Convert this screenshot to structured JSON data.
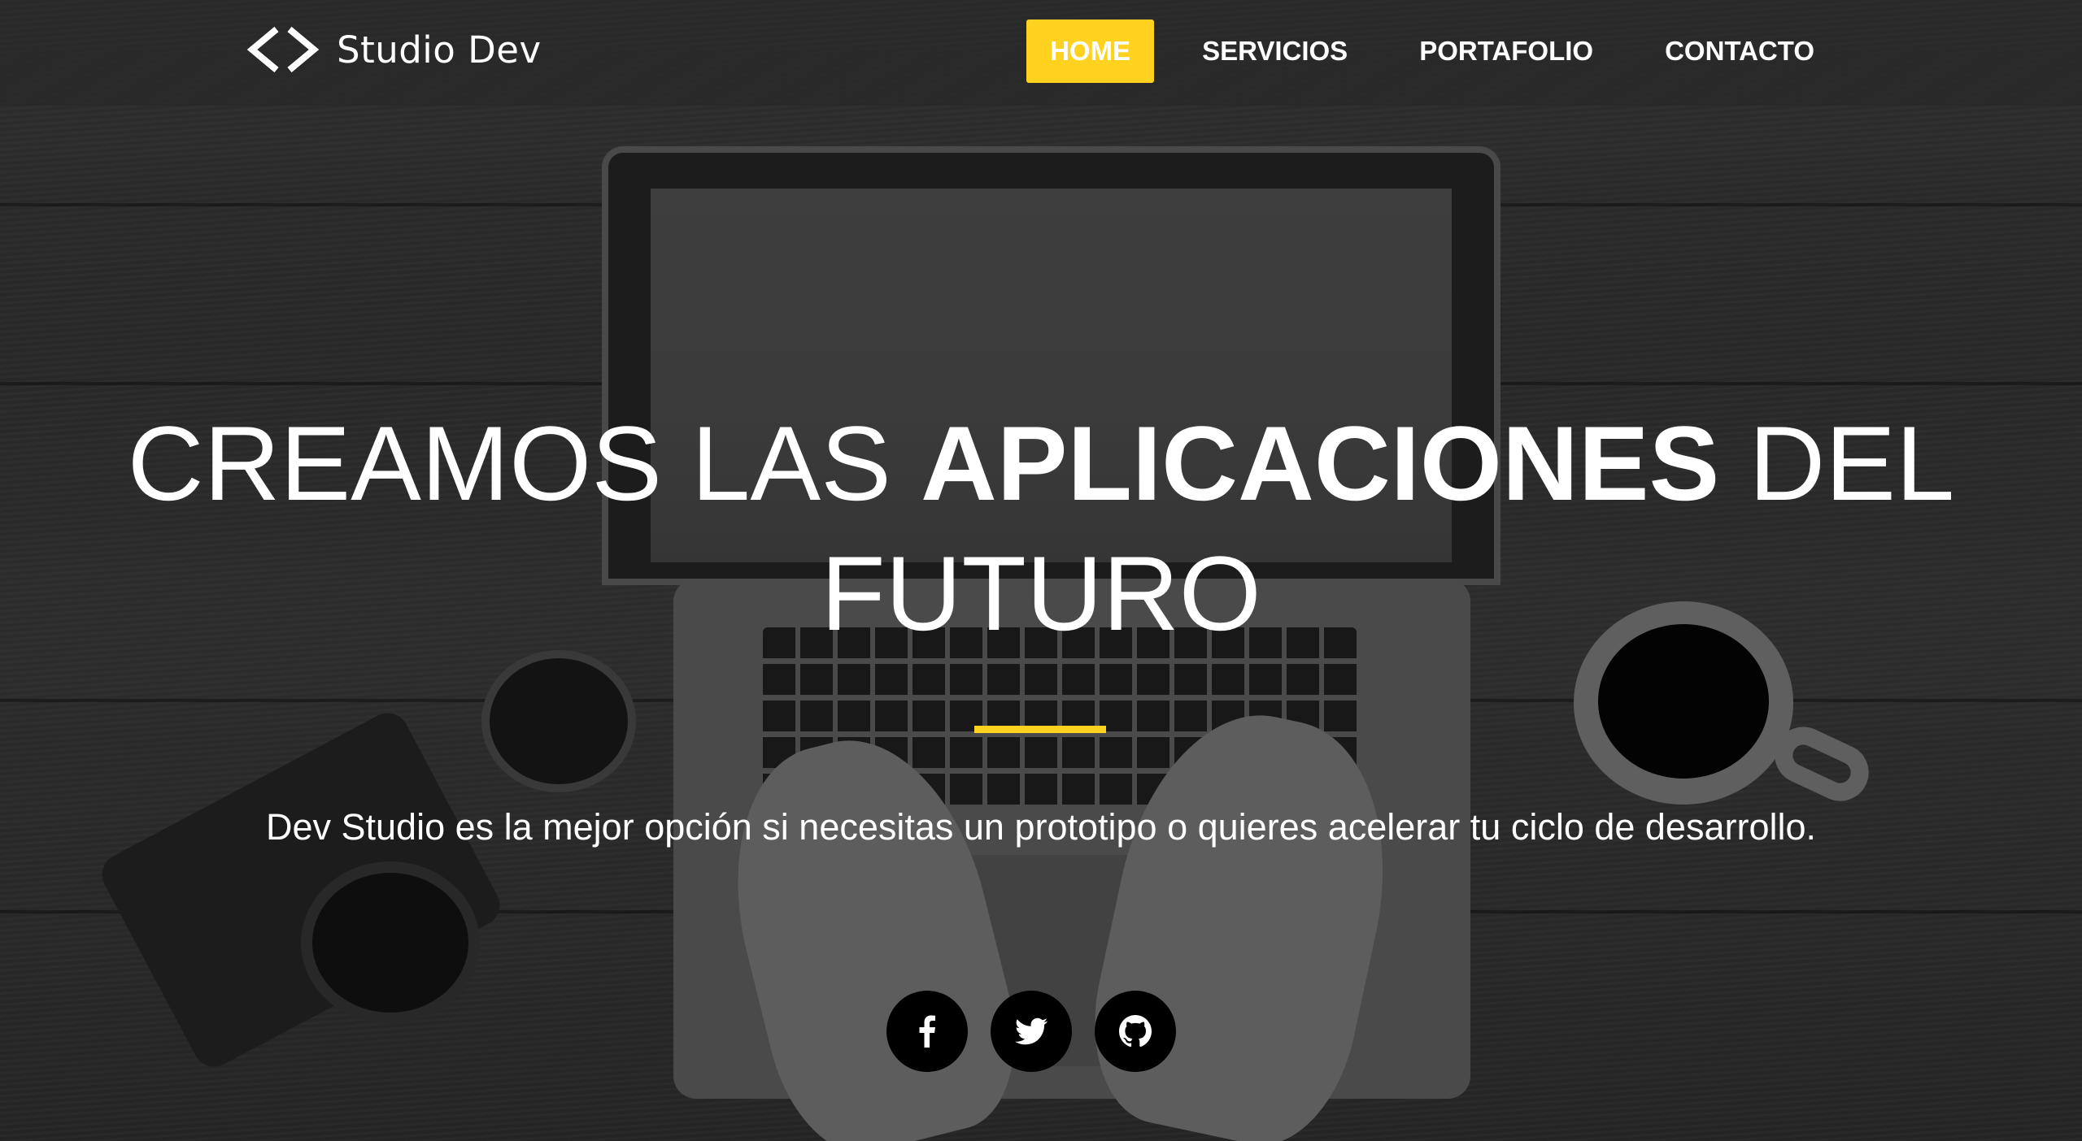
{
  "brand": {
    "name": "Studio Dev",
    "icon": "code-brackets-icon"
  },
  "nav": {
    "items": [
      {
        "label": "HOME",
        "active": true
      },
      {
        "label": "SERVICIOS",
        "active": false
      },
      {
        "label": "PORTAFOLIO",
        "active": false
      },
      {
        "label": "CONTACTO",
        "active": false
      }
    ]
  },
  "hero": {
    "title_part1": "CREAMOS LAS ",
    "title_bold": "APLICACIONES",
    "title_part2": " DEL FUTURO",
    "subtitle": "Dev Studio es la mejor opción si necesitas un prototipo o quieres acelerar tu ciclo de desarrollo."
  },
  "social": [
    {
      "icon": "facebook-icon"
    },
    {
      "icon": "twitter-icon"
    },
    {
      "icon": "github-icon"
    }
  ],
  "colors": {
    "accent": "#ffd21f",
    "navbar_bg": "#282828",
    "text": "#ffffff",
    "social_bg": "#000000"
  }
}
